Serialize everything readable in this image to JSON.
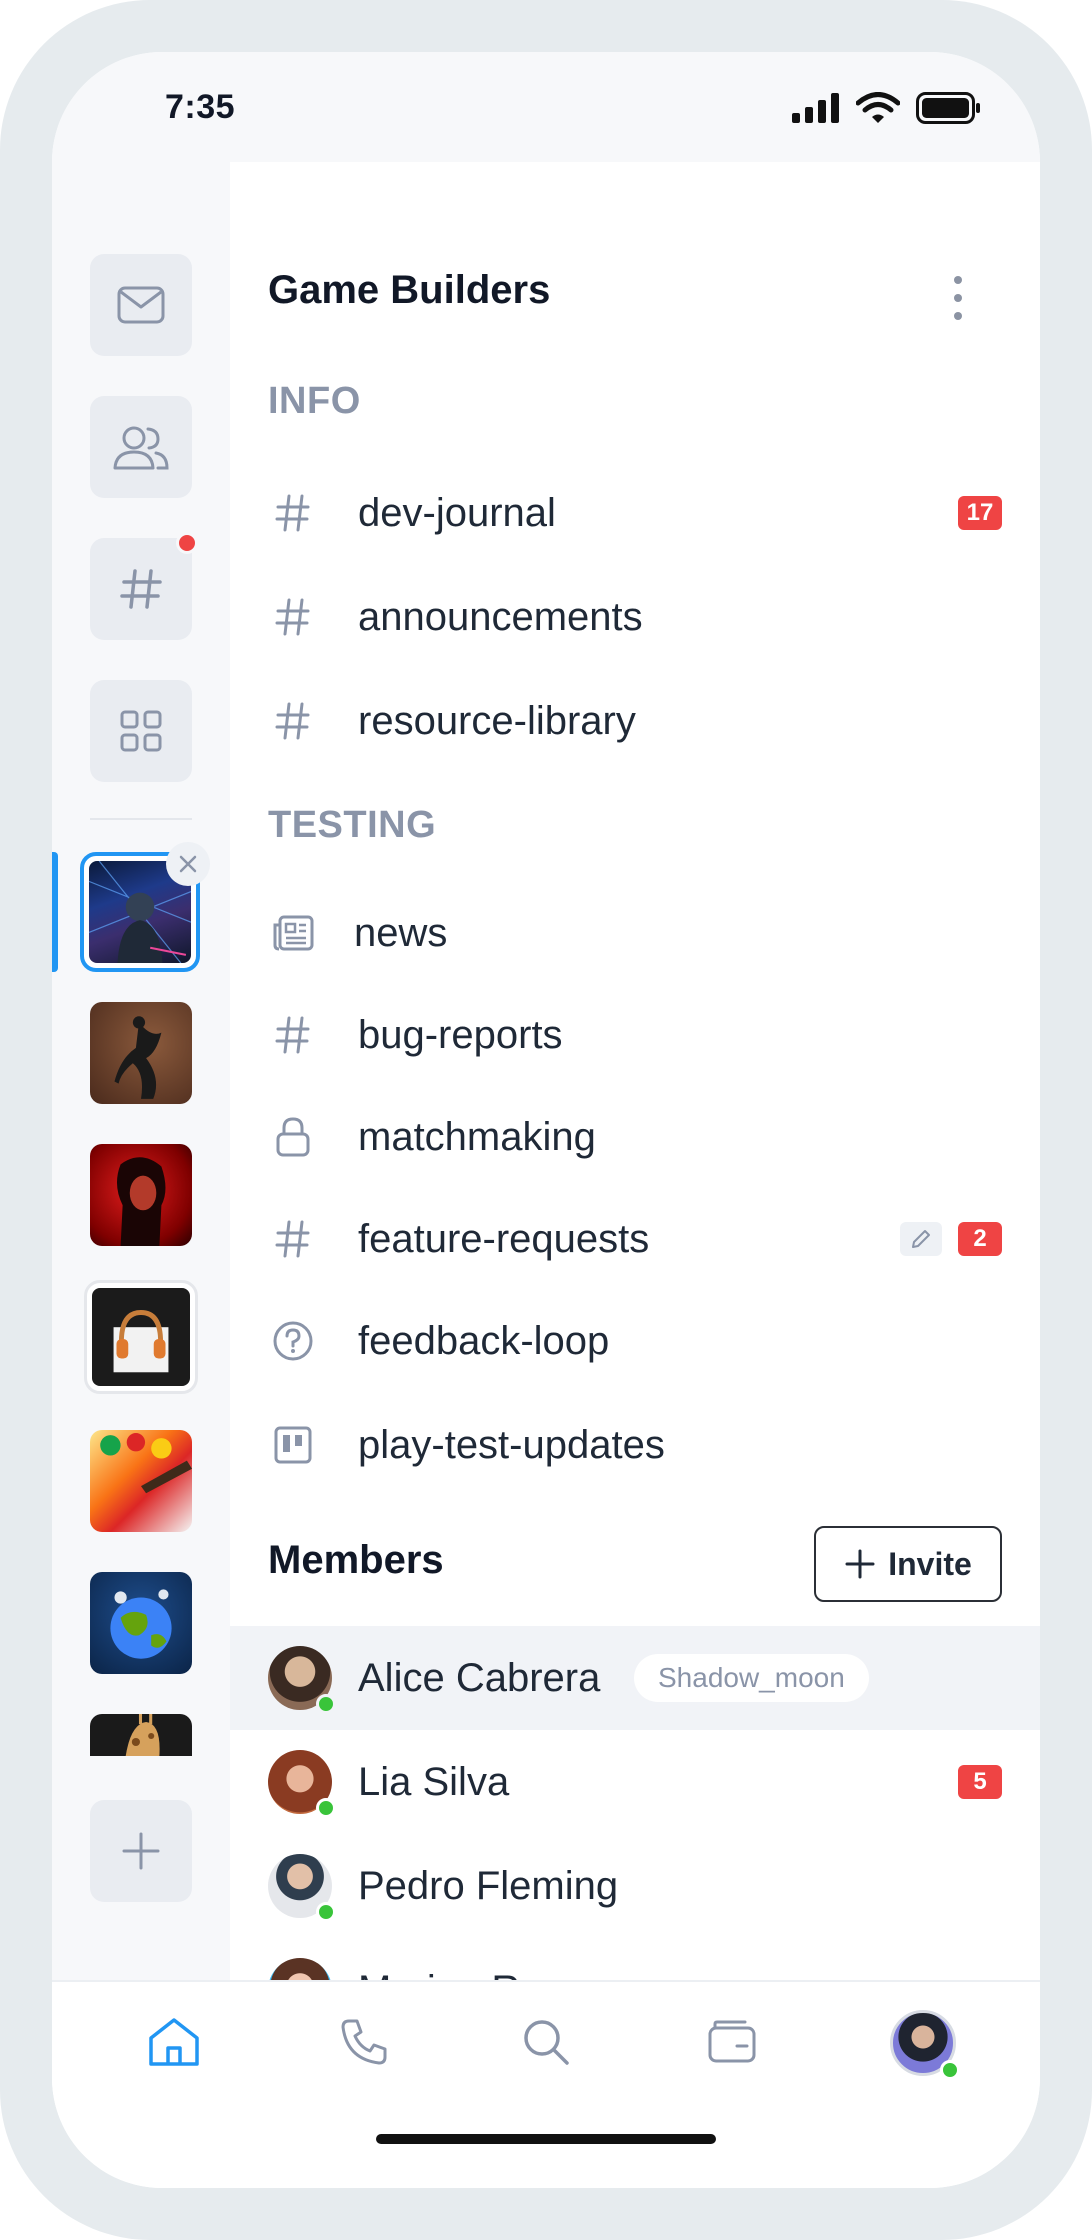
{
  "status_bar": {
    "time": "7:35"
  },
  "rail": {
    "nav": [
      {
        "name": "messages",
        "icon": "mail-icon"
      },
      {
        "name": "friends",
        "icon": "users-icon"
      },
      {
        "name": "channels",
        "icon": "hash-icon",
        "notification_dot": true
      },
      {
        "name": "apps",
        "icon": "grid-icon"
      }
    ],
    "servers": [
      {
        "name": "game-builders",
        "active": true
      },
      {
        "name": "dancer"
      },
      {
        "name": "red-portrait"
      },
      {
        "name": "headphones"
      },
      {
        "name": "paint"
      },
      {
        "name": "planet"
      },
      {
        "name": "giraffe"
      }
    ],
    "add_icon": "plus-icon"
  },
  "server": {
    "title": "Game Builders",
    "sections": [
      {
        "title": "INFO",
        "channels": [
          {
            "icon": "hash-icon",
            "name": "dev-journal",
            "badge": "17"
          },
          {
            "icon": "hash-icon",
            "name": "announcements"
          },
          {
            "icon": "hash-icon",
            "name": "resource-library"
          }
        ]
      },
      {
        "title": "TESTING",
        "channels": [
          {
            "icon": "news-icon",
            "name": "news"
          },
          {
            "icon": "hash-icon",
            "name": "bug-reports"
          },
          {
            "icon": "lock-icon",
            "name": "matchmaking"
          },
          {
            "icon": "hash-icon",
            "name": "feature-requests",
            "badge": "2",
            "draft": true
          },
          {
            "icon": "help-circle-icon",
            "name": "feedback-loop"
          },
          {
            "icon": "board-icon",
            "name": "play-test-updates"
          }
        ]
      }
    ]
  },
  "members": {
    "title": "Members",
    "invite_label": "Invite",
    "list": [
      {
        "name": "Alice Cabrera",
        "tag": "Shadow_moon",
        "online": true,
        "highlighted": true
      },
      {
        "name": "Lia Silva",
        "badge": "5",
        "online": true
      },
      {
        "name": "Pedro Fleming",
        "online": true
      },
      {
        "name": "Marina Roman",
        "online": true
      }
    ]
  },
  "tabbar": {
    "tabs": [
      {
        "name": "home",
        "icon": "home-icon",
        "active": true
      },
      {
        "name": "calls",
        "icon": "phone-icon"
      },
      {
        "name": "search",
        "icon": "search-icon"
      },
      {
        "name": "wallet",
        "icon": "wallet-icon"
      },
      {
        "name": "profile",
        "icon": "avatar"
      }
    ]
  },
  "colors": {
    "accent": "#2196f3",
    "badge": "#ef4444",
    "online": "#39c43a",
    "muted": "#8a94a8"
  }
}
